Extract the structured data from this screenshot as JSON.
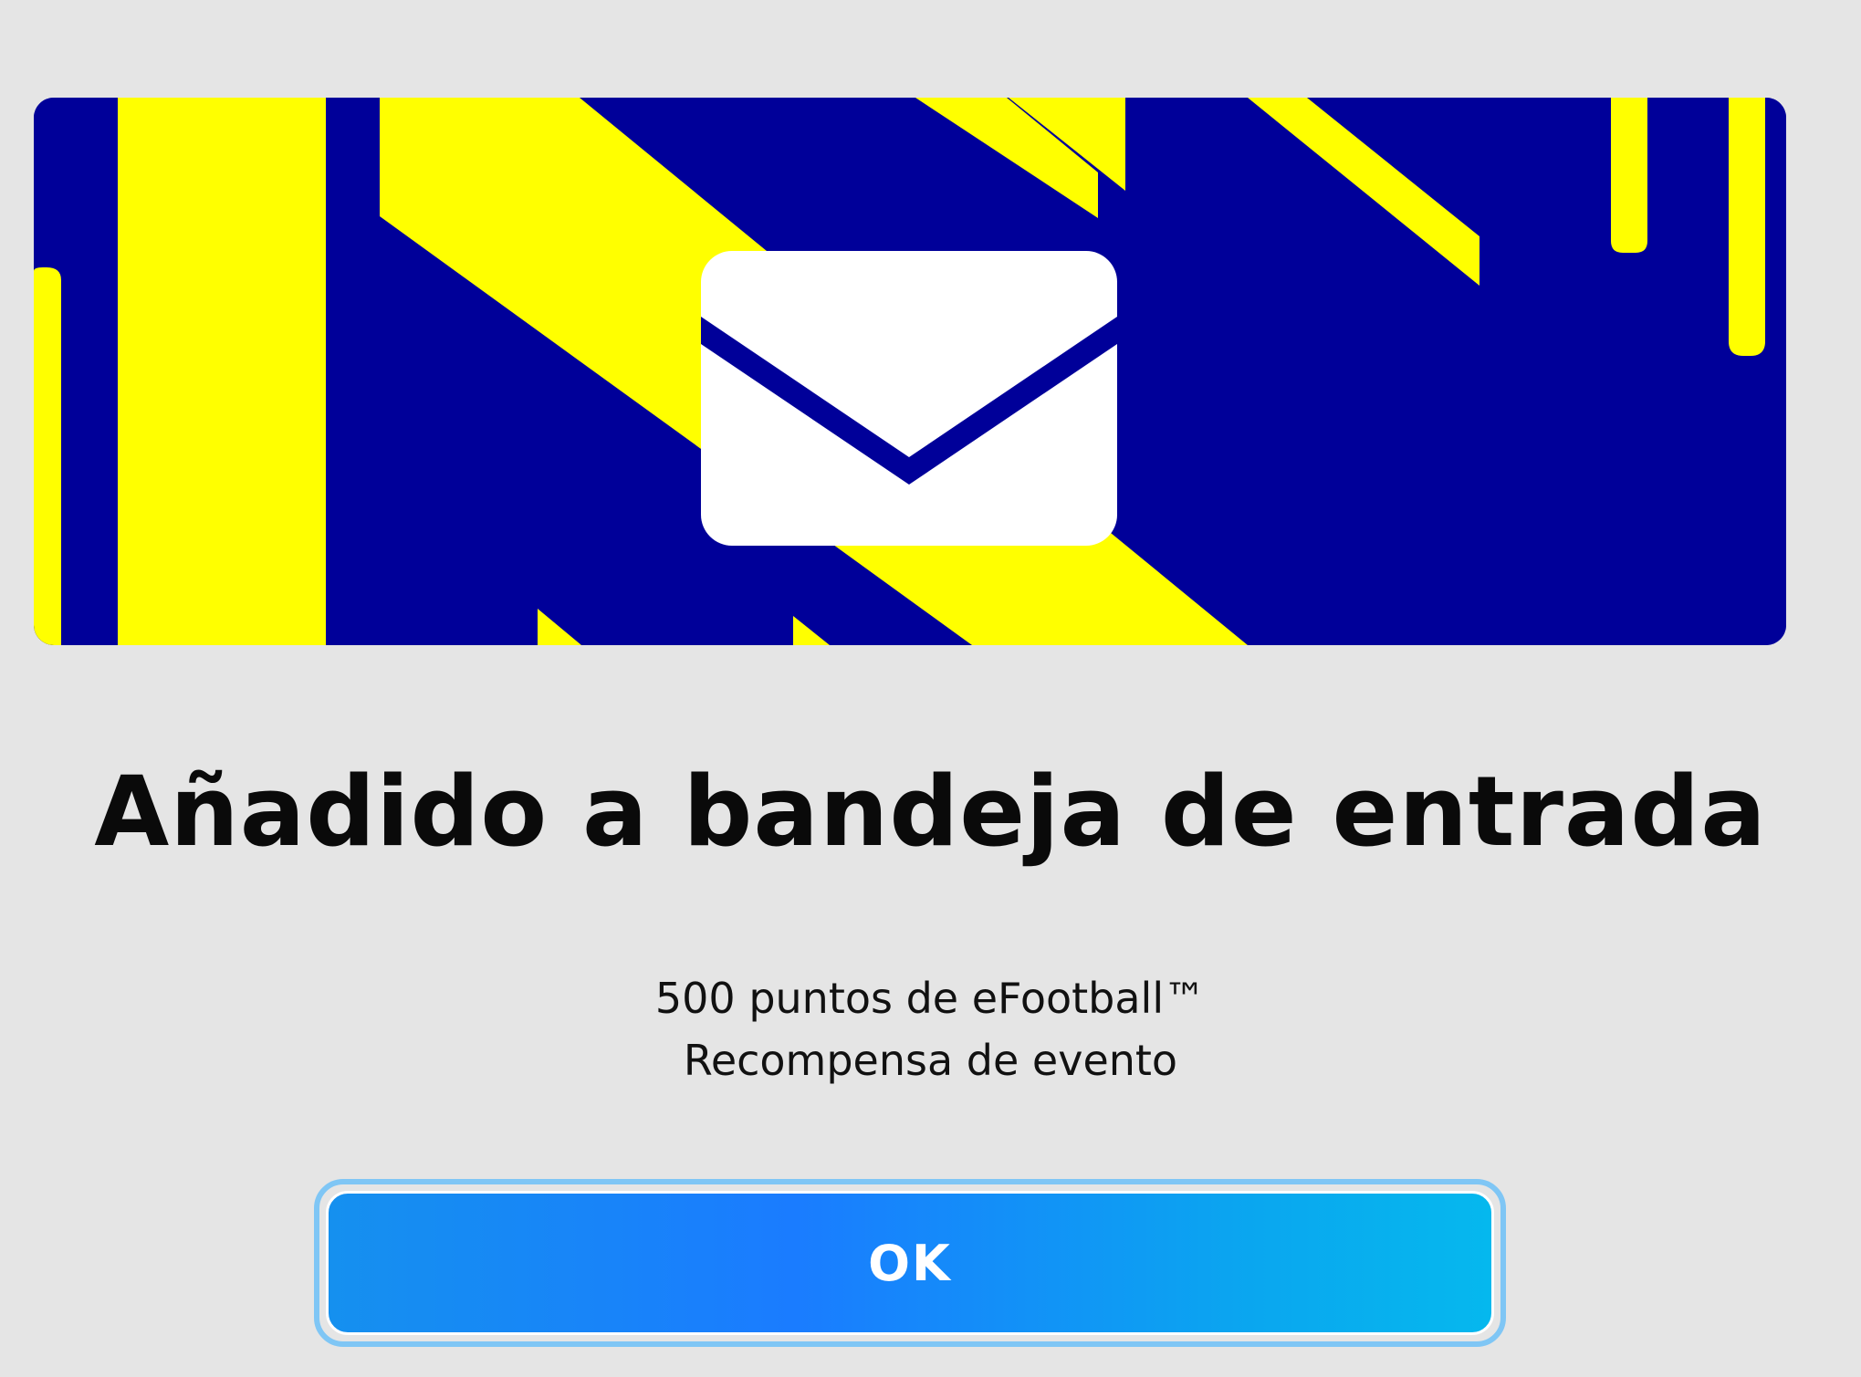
{
  "dialog": {
    "icon": "envelope-icon",
    "title": "Añadido a bandeja de entrada",
    "reward_name": "500 puntos de eFootball™",
    "reward_source": "Recompensa de evento",
    "ok_label": "OK"
  },
  "colors": {
    "background": "#e5e5e5",
    "banner_blue": "#000099",
    "banner_yellow": "#ffff00",
    "button_gradient_start": "#1590ef",
    "button_gradient_end": "#05b8ee"
  }
}
